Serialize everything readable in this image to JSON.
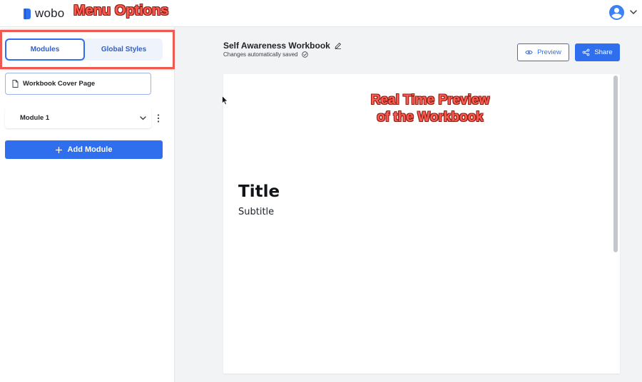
{
  "app": {
    "logo_text": "wobo"
  },
  "annotations": {
    "menu_options": "Menu Options",
    "preview_line1": "Real Time Preview",
    "preview_line2": "of the Workbook"
  },
  "sidebar": {
    "tabs": [
      {
        "label": "Modules",
        "active": true
      },
      {
        "label": "Global Styles",
        "active": false
      }
    ],
    "cover_page_label": "Workbook Cover Page",
    "modules": [
      {
        "label": "Module 1"
      }
    ],
    "add_module_label": "Add Module"
  },
  "header": {
    "doc_title": "Self Awareness Workbook",
    "save_status": "Changes automatically saved",
    "preview_label": "Preview",
    "share_label": "Share"
  },
  "canvas": {
    "title": "Title",
    "subtitle": "Subtitle"
  },
  "icons": [
    "logo-icon",
    "user-avatar-icon",
    "chevron-down-icon",
    "document-icon",
    "kebab-menu-icon",
    "plus-icon",
    "edit-icon",
    "check-circle-icon",
    "eye-icon",
    "share-icon",
    "cursor-icon"
  ],
  "colors": {
    "accent": "#2f6fed",
    "annotation": "#ff5a4e",
    "canvas_bg": "#f2f3f5"
  }
}
